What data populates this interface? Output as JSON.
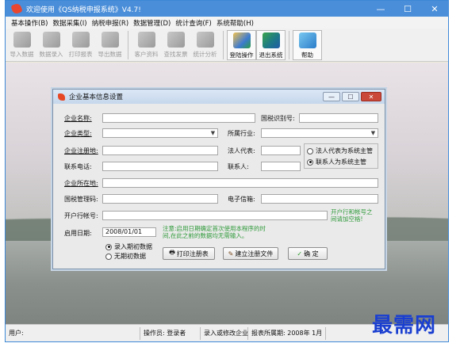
{
  "window": {
    "title": "欢迎使用《QS纳税申报系统》V4.7!",
    "min_icon": "minimize-icon",
    "max_icon": "maximize-icon",
    "close_icon": "close-icon",
    "min_glyph": "—",
    "max_glyph": "☐",
    "close_glyph": "✕"
  },
  "menubar": {
    "items": [
      "基本操作(B)",
      "数据采集(I)",
      "纳税申报(R)",
      "数据管理(D)",
      "统计查询(F)",
      "系统帮助(H)"
    ]
  },
  "toolbar": {
    "items": [
      {
        "label": "导入数据",
        "enabled": false
      },
      {
        "label": "数据录入",
        "enabled": false
      },
      {
        "label": "打印报表",
        "enabled": false
      },
      {
        "label": "导出数据",
        "enabled": false
      },
      {
        "label": "客户资料",
        "enabled": false
      },
      {
        "label": "查找发票",
        "enabled": false
      },
      {
        "label": "统计分析",
        "enabled": false
      },
      {
        "label": "登陆操作",
        "enabled": true
      },
      {
        "label": "退出系统",
        "enabled": true
      },
      {
        "label": "帮助",
        "enabled": true
      }
    ]
  },
  "dialog": {
    "title": "企业基本信息设置",
    "labels": {
      "company_name": "企业名称:",
      "tax_id": "国税识别号:",
      "company_type": "企业类型:",
      "industry": "所属行业:",
      "reg_address": "企业注册地:",
      "legal_rep": "法人代表:",
      "phone": "联系电话:",
      "contact": "联系人:",
      "location": "企业所在地:",
      "tax_code": "国税管理码:",
      "email": "电子信箱:",
      "bank_account": "开户行帐号:",
      "start_date": "启用日期:"
    },
    "values": {
      "start_date": "2008/01/01"
    },
    "radios_manager": [
      {
        "label": "法人代表为系统主管",
        "checked": false
      },
      {
        "label": "联系人为系统主管",
        "checked": true
      }
    ],
    "radios_data": [
      {
        "label": "录入期初数据",
        "checked": true
      },
      {
        "label": "无期初数据",
        "checked": false
      }
    ],
    "bank_note_line1": "开户行和帐号之",
    "bank_note_line2": "间请加空格!",
    "date_note_line1": "注意:启用日期确定首次使用本程序的时",
    "date_note_line2": "间,在此之前的数据均无需输入。",
    "buttons": {
      "print": "打印注册表",
      "register": "建立注册文件",
      "ok": "确 定"
    }
  },
  "statusbar": {
    "user": "用户:",
    "operator": "操作员: 登录者",
    "hint": "录入或修改企业",
    "period": "报表所属期: 2008年 1月"
  },
  "watermark": "最需网",
  "colors": {
    "titlebar": "#4a8ed9",
    "note_red": "#d8372a",
    "note_green": "#2f9a3a",
    "watermark": "#1a3fd0"
  }
}
